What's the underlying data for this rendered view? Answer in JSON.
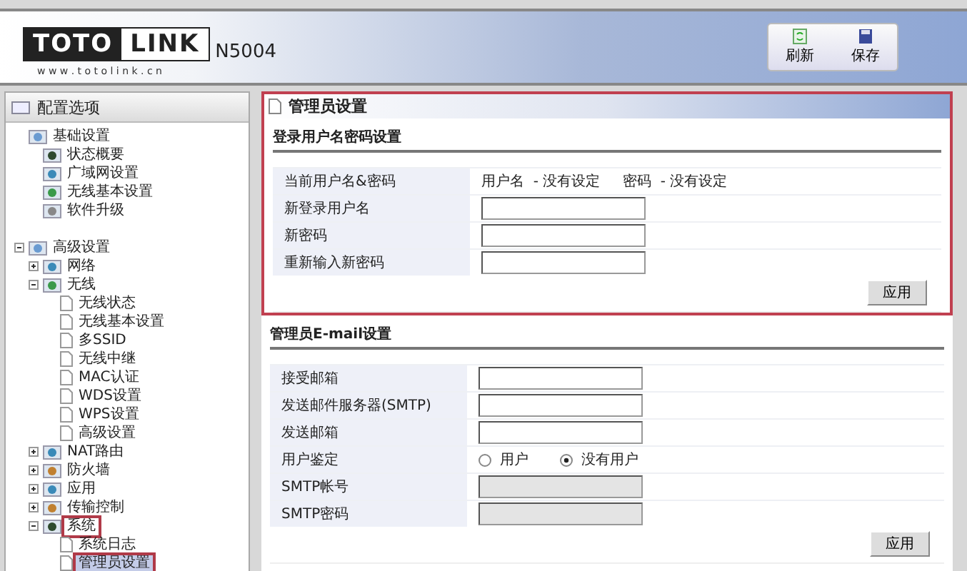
{
  "header": {
    "logo_left": "TOTO",
    "logo_right": "LINK",
    "logo_url": "w w w . t o t o l i n k . c n",
    "model": "N5004",
    "buttons": [
      {
        "label": "刷新",
        "kind": "refresh"
      },
      {
        "label": "保存",
        "kind": "save"
      }
    ]
  },
  "sidebar": {
    "title": "配置选项",
    "tree": [
      {
        "label": "基础设置",
        "kind": "group",
        "children": [
          {
            "label": "状态概要",
            "kind": "status"
          },
          {
            "label": "广域网设置",
            "kind": "globe"
          },
          {
            "label": "无线基本设置",
            "kind": "wireless"
          },
          {
            "label": "软件升级",
            "kind": "upgrade"
          }
        ]
      },
      {
        "label": "高级设置",
        "kind": "group",
        "expanded": true,
        "children": [
          {
            "label": "网络",
            "kind": "globe",
            "expanded": false
          },
          {
            "label": "无线",
            "kind": "wireless",
            "expanded": true,
            "children": [
              {
                "label": "无线状态",
                "kind": "page"
              },
              {
                "label": "无线基本设置",
                "kind": "page"
              },
              {
                "label": "多SSID",
                "kind": "page"
              },
              {
                "label": "无线中继",
                "kind": "page"
              },
              {
                "label": "MAC认证",
                "kind": "page"
              },
              {
                "label": "WDS设置",
                "kind": "page"
              },
              {
                "label": "WPS设置",
                "kind": "page"
              },
              {
                "label": "高级设置",
                "kind": "page"
              }
            ]
          },
          {
            "label": "NAT路由",
            "kind": "globe",
            "expanded": false
          },
          {
            "label": "防火墙",
            "kind": "firewall",
            "expanded": false
          },
          {
            "label": "应用",
            "kind": "globe",
            "expanded": false
          },
          {
            "label": "传输控制",
            "kind": "firewall",
            "expanded": false
          },
          {
            "label": "系统",
            "kind": "status",
            "expanded": true,
            "highlighted": true,
            "children": [
              {
                "label": "系统日志",
                "kind": "page",
                "selected": false
              },
              {
                "label": "管理员设置",
                "kind": "page",
                "selected": true,
                "highlighted": true
              }
            ]
          }
        ]
      }
    ]
  },
  "main": {
    "title": "管理员设置",
    "highlighted": true,
    "sections": [
      {
        "title": "登录用户名密码设置",
        "rows": [
          {
            "label": "当前用户名&密码",
            "kind": "text",
            "value": "用户名  - 没有设定     密码  - 没有设定"
          },
          {
            "label": "新登录用户名",
            "kind": "input",
            "disabled": false
          },
          {
            "label": "新密码",
            "kind": "input",
            "disabled": false
          },
          {
            "label": "重新输入新密码",
            "kind": "input",
            "disabled": false
          }
        ],
        "button": "应用"
      },
      {
        "title": "管理员E-mail设置",
        "rows": [
          {
            "label": "接受邮箱",
            "kind": "input",
            "disabled": false
          },
          {
            "label": "发送邮件服务器(SMTP)",
            "kind": "input",
            "disabled": false
          },
          {
            "label": "发送邮箱",
            "kind": "input",
            "disabled": false
          },
          {
            "label": "用户鉴定",
            "kind": "radio",
            "options": [
              {
                "label": "用户",
                "selected": false
              },
              {
                "label": "没有用户",
                "selected": true
              }
            ]
          },
          {
            "label": "SMTP帐号",
            "kind": "input",
            "disabled": true
          },
          {
            "label": "SMTP密码",
            "kind": "input",
            "disabled": true
          }
        ],
        "button": "应用"
      }
    ]
  }
}
